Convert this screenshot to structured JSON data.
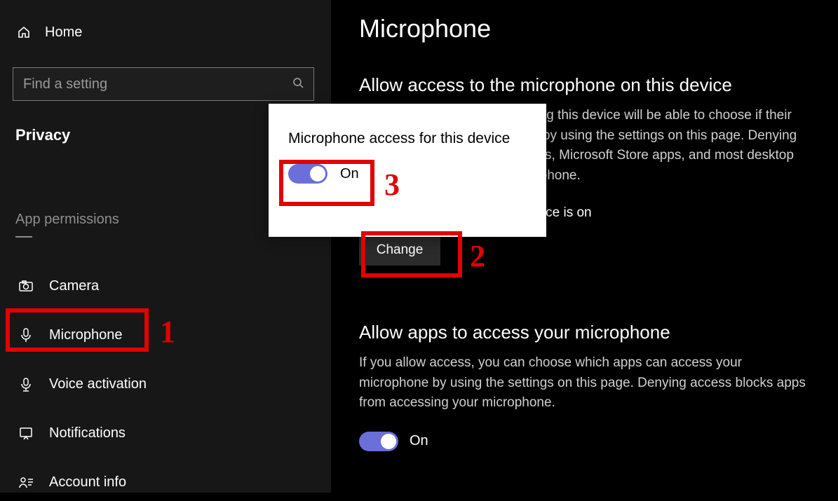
{
  "sidebar": {
    "home_label": "Home",
    "search_placeholder": "Find a setting",
    "category_label": "Privacy",
    "section_label": "App permissions",
    "items": [
      {
        "label": "Camera"
      },
      {
        "label": "Microphone"
      },
      {
        "label": "Voice activation"
      },
      {
        "label": "Notifications"
      },
      {
        "label": "Account info"
      }
    ]
  },
  "main": {
    "page_title": "Microphone",
    "section1_title": "Allow access to the microphone on this device",
    "section1_body": "If you allow access, people using this device will be able to choose if their apps have microphone access by using the settings on this page. Denying access blocks Windows features, Microsoft Store apps, and most desktop apps from accessing the microphone.",
    "status_text": "Microphone access for this device is on",
    "change_label": "Change",
    "section2_title": "Allow apps to access your microphone",
    "section2_body": "If you allow access, you can choose which apps can access your microphone by using the settings on this page. Denying access blocks apps from accessing your microphone.",
    "apps_toggle_label": "On"
  },
  "popup": {
    "title": "Microphone access for this device",
    "toggle_label": "On"
  },
  "annotations": {
    "n1": "1",
    "n2": "2",
    "n3": "3"
  },
  "colors": {
    "toggle_on": "#6b6fd8",
    "annotation": "#E20000"
  }
}
